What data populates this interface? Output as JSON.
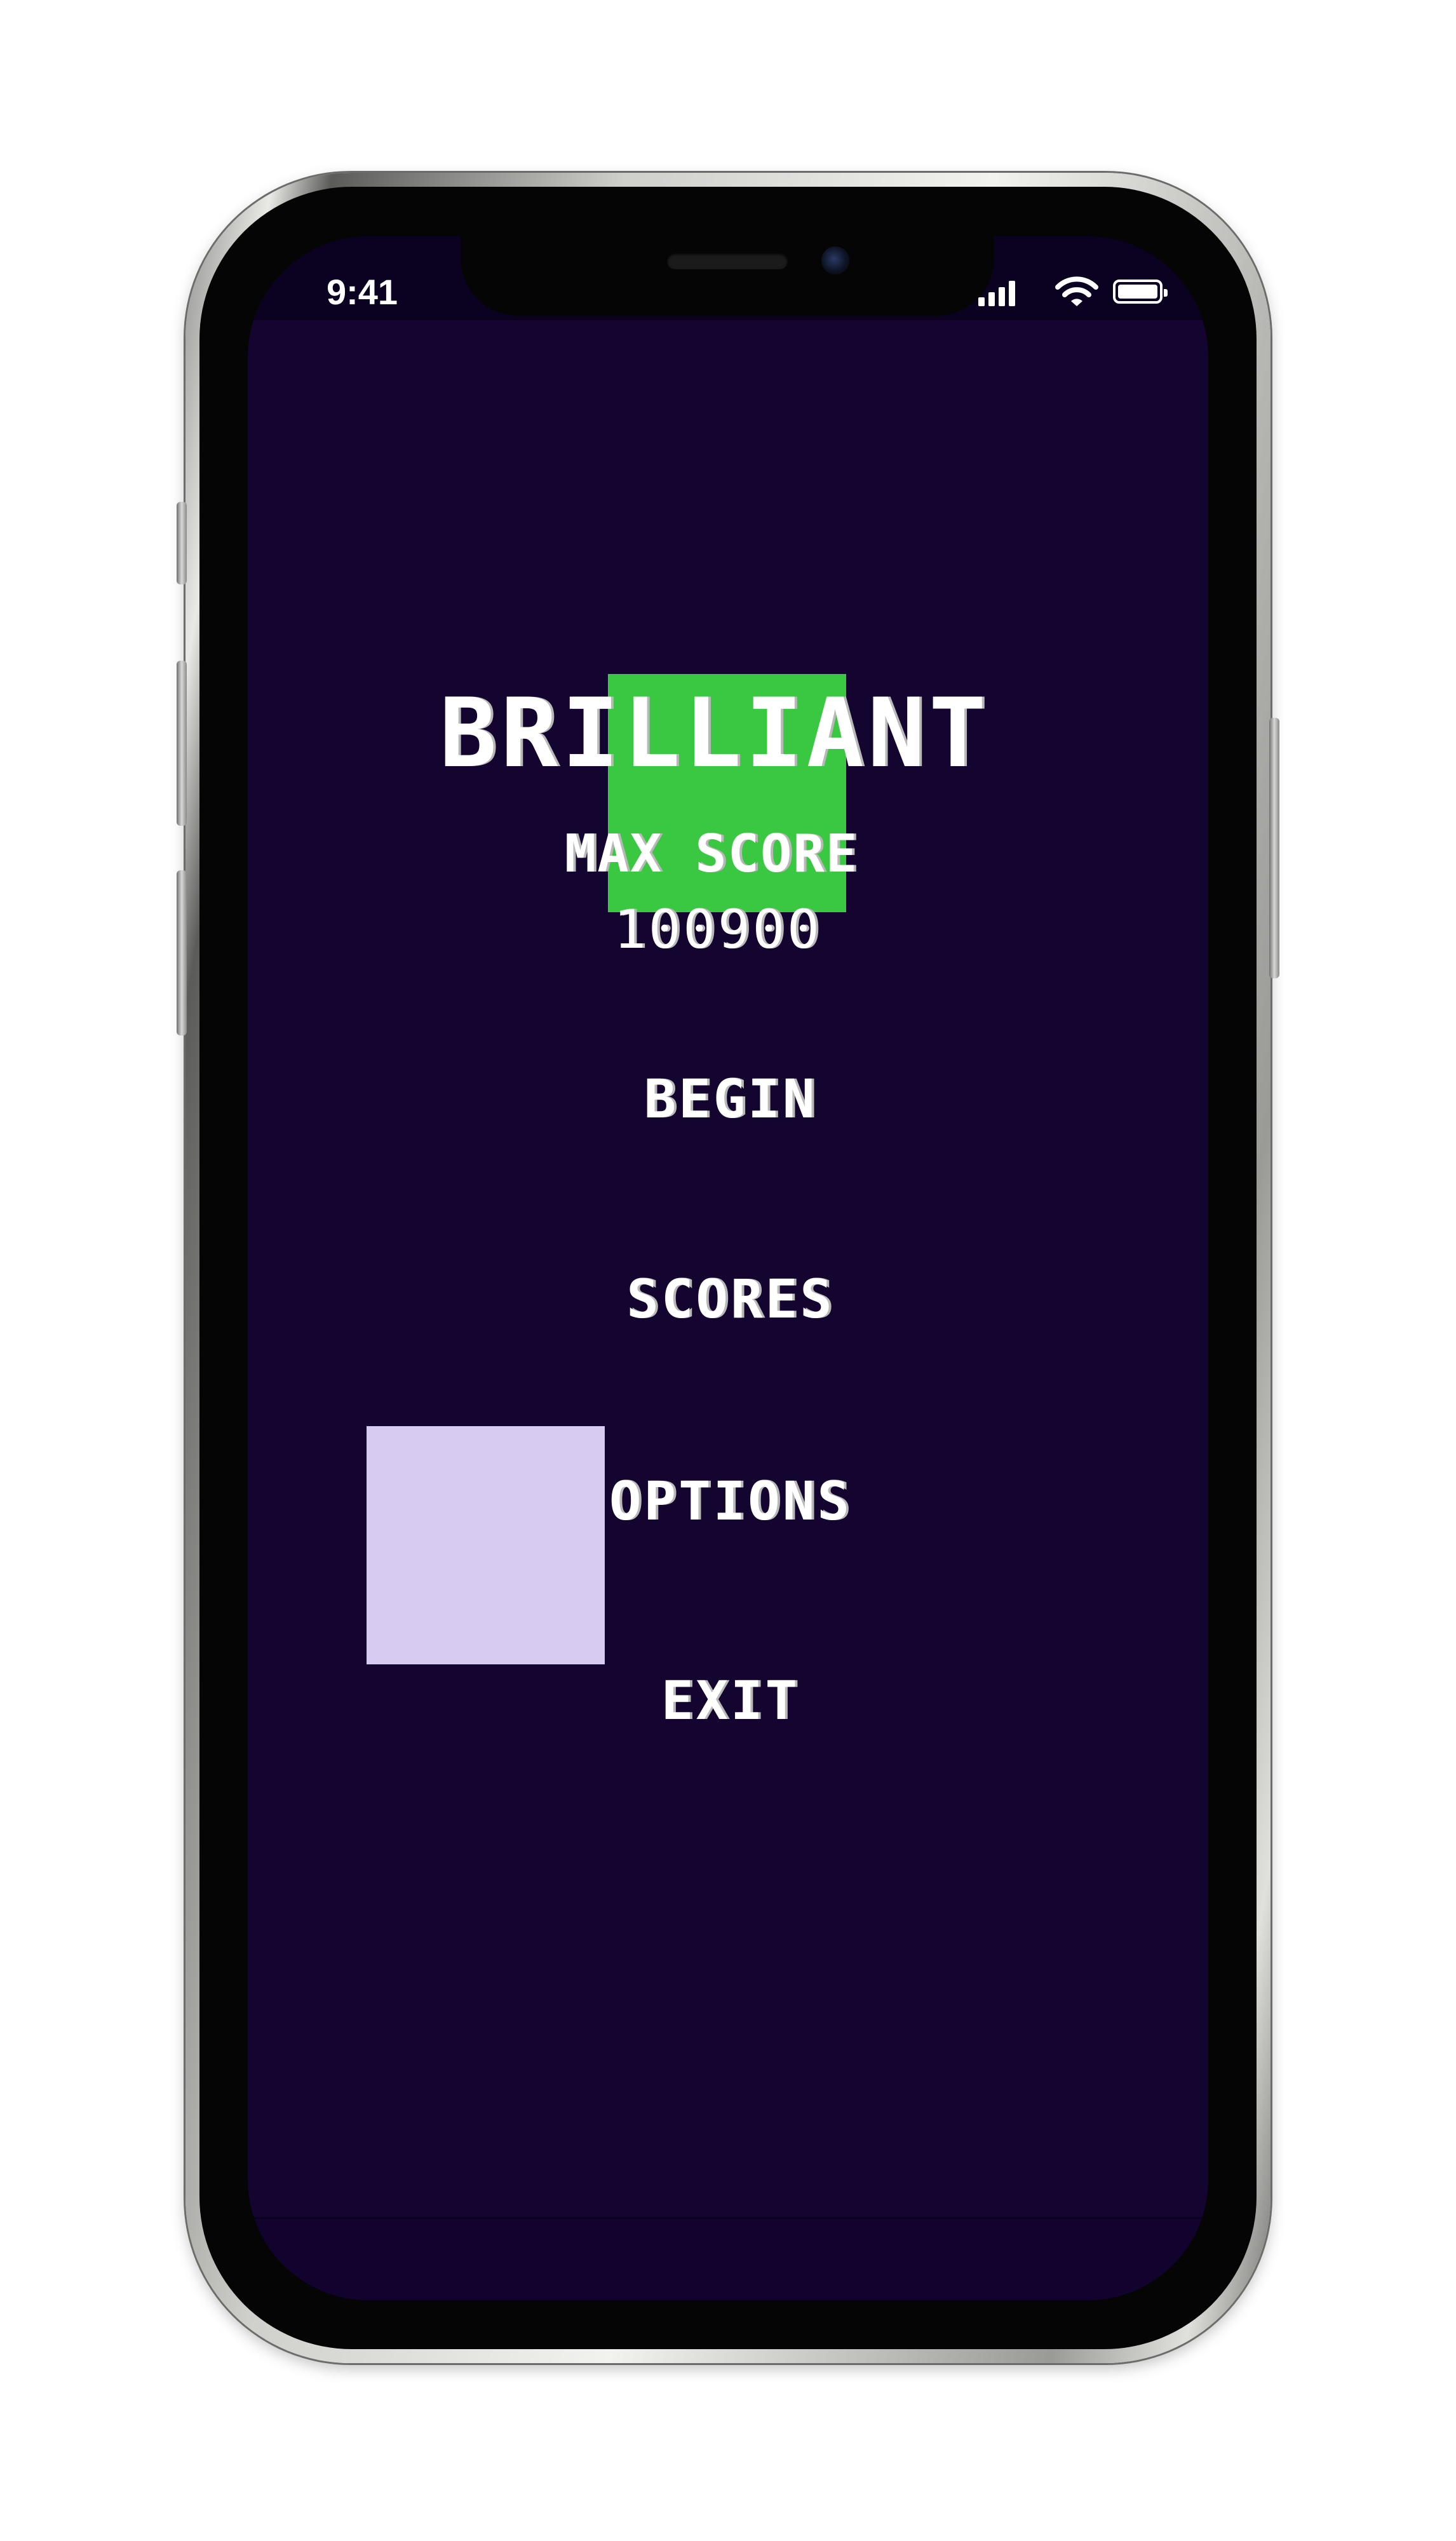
{
  "status_bar": {
    "time": "9:41",
    "icons": [
      "cellular-signal-icon",
      "wifi-icon",
      "battery-icon"
    ]
  },
  "game": {
    "title": "BRILLIANT",
    "max_score_label": "MAX SCORE",
    "max_score_value": "100900",
    "menu": {
      "begin": "BEGIN",
      "scores": "SCORES",
      "options": "OPTIONS",
      "exit": "EXIT"
    }
  },
  "colors": {
    "screen_background": "#130430",
    "text": "#ffffff",
    "green_block": "#3ac842",
    "lilac_block": "#d8cbf2",
    "device_frame": "#cfcfcc"
  }
}
